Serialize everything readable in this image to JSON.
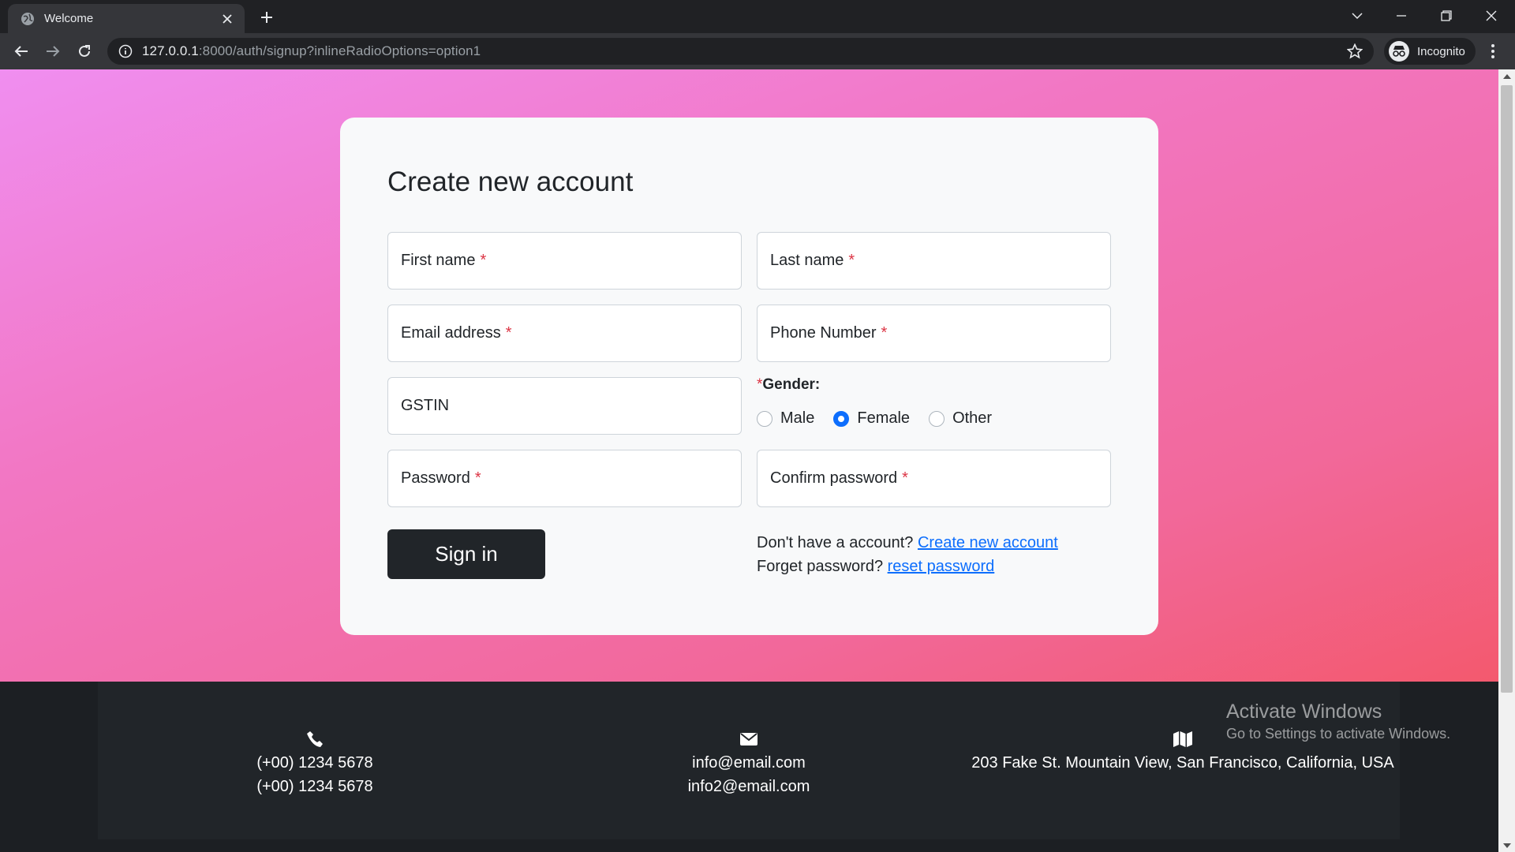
{
  "browser": {
    "tab_title": "Welcome",
    "url_host": "127.0.0.1",
    "url_rest": ":8000/auth/signup?inlineRadioOptions=option1",
    "profile_label": "Incognito"
  },
  "form": {
    "title": "Create new account",
    "first_name": "First name",
    "last_name": "Last name",
    "email": "Email address",
    "phone": "Phone Number",
    "gstin": "GSTIN",
    "password": "Password",
    "confirm_password": "Confirm password",
    "required_mark": "*",
    "gender_label": "Gender:",
    "gender_options": [
      "Male",
      "Female",
      "Other"
    ],
    "gender_selected": "Female",
    "submit_label": "Sign in",
    "no_account_text": "Don't have a account?",
    "create_link": "Create new account",
    "forgot_text": "Forget password?",
    "reset_link": "reset password"
  },
  "footer": {
    "phone_lines": [
      "(+00) 1234 5678",
      "(+00) 1234 5678"
    ],
    "email_lines": [
      "info@email.com",
      "info2@email.com"
    ],
    "address_line": "203 Fake St. Mountain View, San Francisco, California, USA"
  },
  "watermark": {
    "title": "Activate Windows",
    "subtitle": "Go to Settings to activate Windows."
  },
  "colors": {
    "accent": "#0d6efd",
    "required": "#dc3545",
    "dark": "#212529"
  }
}
